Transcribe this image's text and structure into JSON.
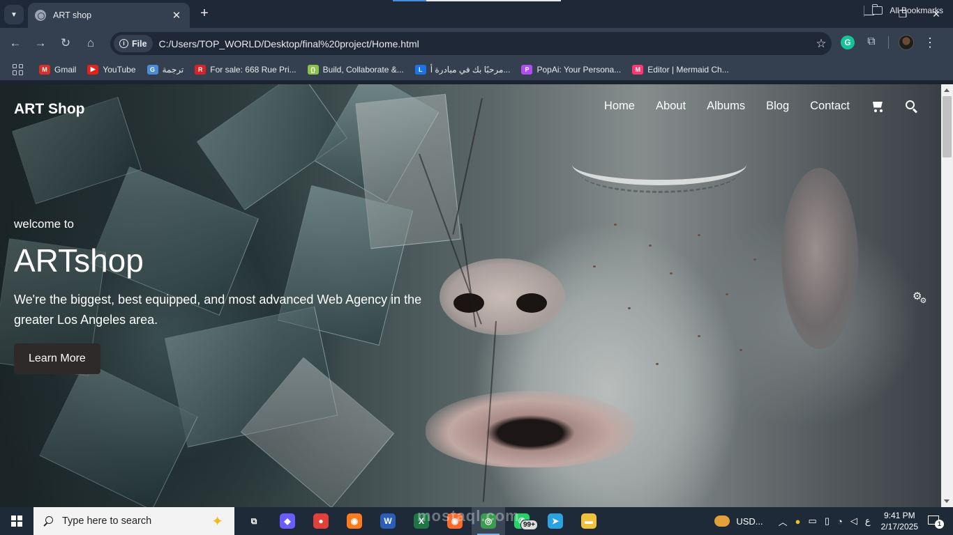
{
  "browser": {
    "tab_title": "ART shop",
    "tab_close": "✕",
    "new_tab": "+",
    "site_chip": "File",
    "url": "C:/Users/TOP_WORLD/Desktop/final%20project/Home.html",
    "bookmarks": [
      {
        "label": "Gmail",
        "icon": "gmail-icon",
        "color": "#d93025",
        "glyph": "M"
      },
      {
        "label": "YouTube",
        "icon": "youtube-icon",
        "color": "#e62117",
        "glyph": "▶"
      },
      {
        "label": "ترجمة",
        "icon": "translate-icon",
        "color": "#4a8cd8",
        "glyph": "G"
      },
      {
        "label": "For sale: 668 Rue Pri...",
        "icon": "realtor-icon",
        "color": "#d92228",
        "glyph": "R"
      },
      {
        "label": "Build, Collaborate &...",
        "icon": "build-icon",
        "color": "#8bc34a",
        "glyph": "{}"
      },
      {
        "label": "مرحبًا بك في مبادرة أ...",
        "icon": "initiative-icon",
        "color": "#1a73e8",
        "glyph": "L"
      },
      {
        "label": "PopAi: Your Persona...",
        "icon": "popai-icon",
        "color": "#b14cf0",
        "glyph": "P"
      },
      {
        "label": "Editor | Mermaid Ch...",
        "icon": "mermaid-icon",
        "color": "#ff3670",
        "glyph": "M"
      }
    ],
    "all_bookmarks": "All Bookmarks"
  },
  "site": {
    "brand": "ART Shop",
    "nav": [
      "Home",
      "About",
      "Albums",
      "Blog",
      "Contact"
    ],
    "hero": {
      "kicker": "welcome to",
      "title": "ARTshop",
      "description": "We're the biggest, best equipped, and most advanced Web Agency in the greater Los Angeles area.",
      "cta": "Learn More"
    }
  },
  "taskbar": {
    "search_placeholder": "Type here to search",
    "apps": [
      {
        "name": "task-view-icon",
        "glyph": "⧉",
        "color": "#1f2a38"
      },
      {
        "name": "copilot-icon",
        "glyph": "◆",
        "color": "#6a5cff"
      },
      {
        "name": "screen-recorder-icon",
        "glyph": "●",
        "color": "#e2413a"
      },
      {
        "name": "firefox-icon",
        "glyph": "◉",
        "color": "#ff7a1a"
      },
      {
        "name": "word-icon",
        "glyph": "W",
        "color": "#2b5eb7"
      },
      {
        "name": "excel-icon",
        "glyph": "X",
        "color": "#1d7745"
      },
      {
        "name": "firefox-alt-icon",
        "glyph": "◉",
        "color": "#ff6a2a"
      },
      {
        "name": "chrome-icon",
        "glyph": "◎",
        "color": "#3b9c4f"
      },
      {
        "name": "whatsapp-icon",
        "glyph": "✆",
        "color": "#25d366"
      },
      {
        "name": "telegram-icon",
        "glyph": "➤",
        "color": "#2aa3e0"
      },
      {
        "name": "file-explorer-icon",
        "glyph": "▬",
        "color": "#f0c23c"
      }
    ],
    "whatsapp_badge": "99+",
    "weather": "USD...",
    "language": "ع",
    "time": "9:41 PM",
    "date": "2/17/2025",
    "notifications": "1"
  },
  "watermark": "mostaql.com"
}
